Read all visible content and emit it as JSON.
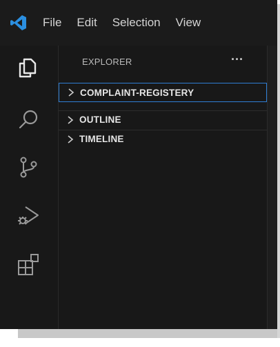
{
  "menu": {
    "items": [
      {
        "label": "File"
      },
      {
        "label": "Edit"
      },
      {
        "label": "Selection"
      },
      {
        "label": "View"
      }
    ]
  },
  "activity_bar": {
    "icons": [
      "explorer-icon",
      "search-icon",
      "source-control-icon",
      "run-debug-icon",
      "extensions-icon"
    ]
  },
  "sidebar": {
    "title": "EXPLORER",
    "more_actions": "···",
    "sections": [
      {
        "label": "COMPLAINT-REGISTERY",
        "collapsed": true
      },
      {
        "label": "OUTLINE",
        "collapsed": true
      },
      {
        "label": "TIMELINE",
        "collapsed": true
      }
    ]
  },
  "colors": {
    "accent": "#2f7fd6",
    "logo": "#2b8fe0",
    "background": "#181818"
  }
}
